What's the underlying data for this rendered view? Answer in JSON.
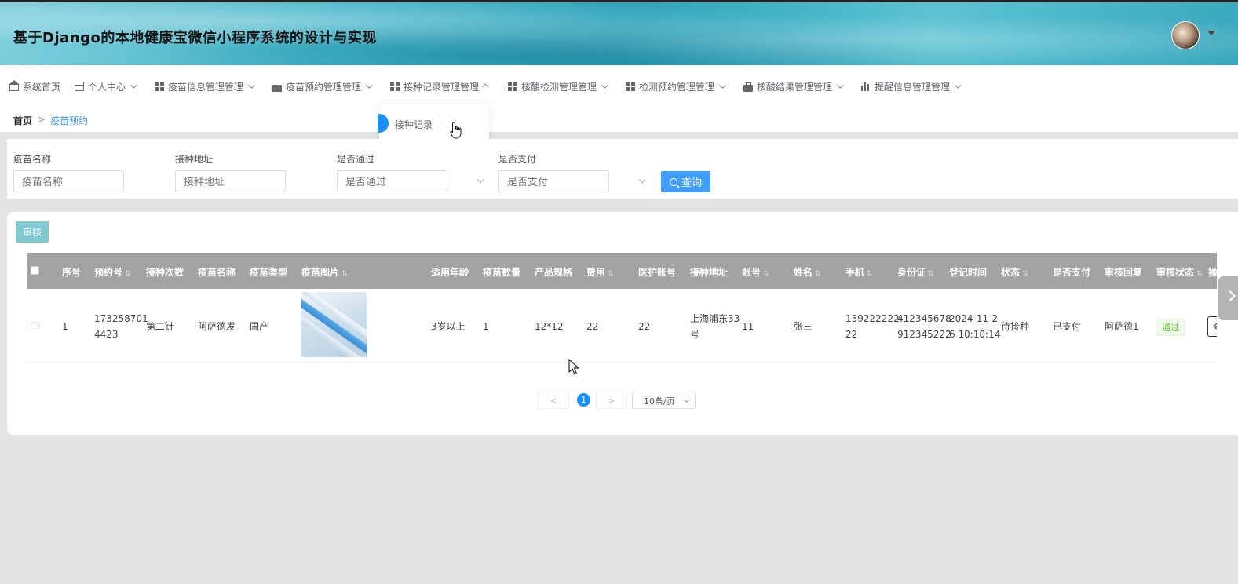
{
  "header": {
    "title": "基于Django的本地健康宝微信小程序系统的设计与实现"
  },
  "nav": {
    "items": [
      {
        "label": "系统首页",
        "icon": "home-icon"
      },
      {
        "label": "个人中心",
        "icon": "card-icon"
      },
      {
        "label": "疫苗信息管理管理",
        "icon": "grid-icon"
      },
      {
        "label": "疫苗预约管理管理",
        "icon": "thumb-icon"
      },
      {
        "label": "接种记录管理管理",
        "icon": "grid-icon"
      },
      {
        "label": "核酸检测管理管理",
        "icon": "grid-icon"
      },
      {
        "label": "检测预约管理管理",
        "icon": "grid-icon"
      },
      {
        "label": "核酸结果管理管理",
        "icon": "bag-icon"
      },
      {
        "label": "提醒信息管理管理",
        "icon": "bar-chart-icon"
      }
    ],
    "dropdown": {
      "label": "接种记录"
    }
  },
  "breadcrumb": {
    "home": "首页",
    "separator": ">",
    "current": "疫苗预约"
  },
  "search": {
    "fields": [
      {
        "label": "疫苗名称",
        "placeholder": "疫苗名称"
      },
      {
        "label": "接种地址",
        "placeholder": "接种地址"
      },
      {
        "label": "是否通过",
        "placeholder": "是否通过"
      },
      {
        "label": "是否支付",
        "placeholder": "是否支付"
      }
    ],
    "button": "查询"
  },
  "toolbar": {
    "audit_label": "审核"
  },
  "table": {
    "columns": [
      "序号",
      "预约号",
      "接种次数",
      "疫苗名称",
      "疫苗类型",
      "疫苗图片",
      "适用年龄",
      "疫苗数量",
      "产品规格",
      "费用",
      "医护账号",
      "接种地址",
      "账号",
      "姓名",
      "手机",
      "身份证",
      "登记时间",
      "状态",
      "是否支付",
      "审核回复",
      "审核状态",
      "操"
    ],
    "rows": [
      {
        "index": "1",
        "booking_no_1": "173258701",
        "booking_no_2": "4423",
        "dose": "第二针",
        "vaccine_name": "阿萨德发",
        "vaccine_type": "国产",
        "age": "3岁以上",
        "quantity": "1",
        "spec": "12*12",
        "fee": "22",
        "staff_account": "22",
        "address_1": "上海浦东33",
        "address_2": "号",
        "account": "11",
        "name": "张三",
        "phone_1": "139222222",
        "phone_2": "22",
        "id_1": "412345678",
        "id_2": "912345222",
        "time_1": "2024-11-2",
        "time_2": "6 10:10:14",
        "status": "待接种",
        "paid": "已支付",
        "reply": "阿萨德1",
        "audit_status": "通过",
        "op": "查"
      }
    ]
  },
  "pagination": {
    "prev": "<",
    "page": "1",
    "next": ">",
    "page_size": "10条/页"
  }
}
